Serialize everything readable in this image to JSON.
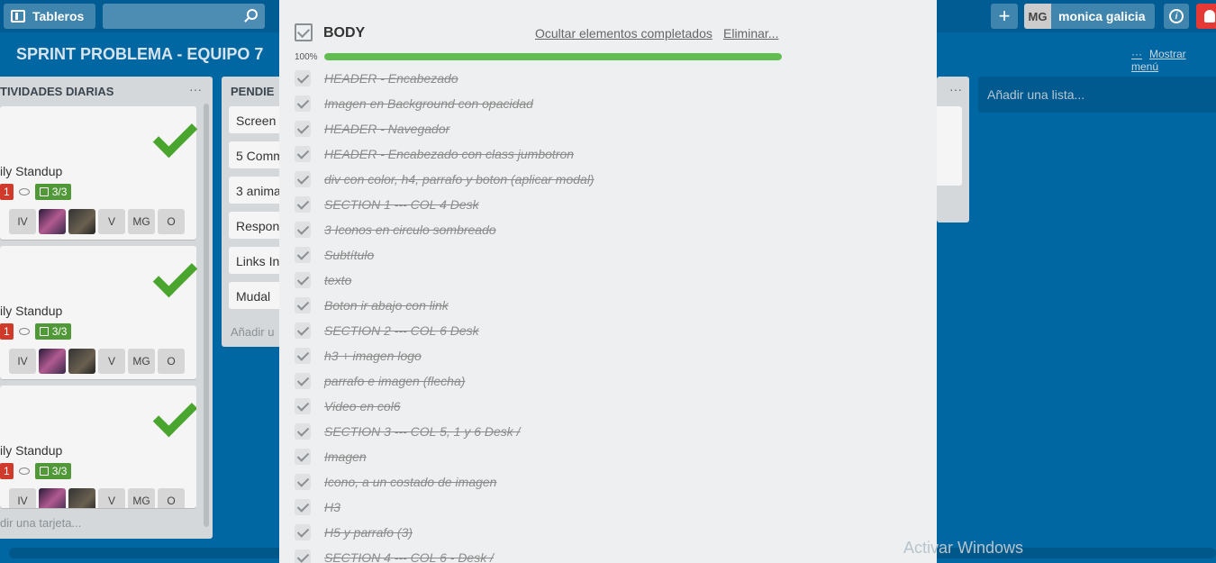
{
  "topbar": {
    "boards_label": "Tableros",
    "plus_label": "+",
    "user_initials": "MG",
    "user_name": "monica galicia",
    "info_label": "i"
  },
  "board": {
    "title": "SPRINT PROBLEMA - EQUIPO 7",
    "menu_dots": "···",
    "menu_label": "Mostrar menú"
  },
  "lists": {
    "daily": {
      "title": "TIVIDADES DIARIAS",
      "dots": "···",
      "add_card": "dir una tarjeta...",
      "cards": [
        {
          "title": "ily Standup",
          "red_badge": "1",
          "checklist": "3/3",
          "members": [
            "IV",
            "",
            "",
            "V",
            "MG",
            "O"
          ]
        },
        {
          "title": "ily Standup",
          "red_badge": "1",
          "checklist": "3/3",
          "members": [
            "IV",
            "",
            "",
            "V",
            "MG",
            "O"
          ]
        },
        {
          "title": "ily Standup",
          "red_badge": "1",
          "checklist": "3/3",
          "members": [
            "IV",
            "",
            "",
            "V",
            "MG",
            "O"
          ]
        }
      ]
    },
    "pending": {
      "title": "PENDIE",
      "items": [
        "Screen",
        "5 Comm",
        "3 anima",
        "Respon",
        "Links In",
        "Mudal"
      ],
      "add_card": "Añadir u"
    },
    "third": {
      "dots": "···"
    },
    "add_list": "Añadir una lista..."
  },
  "modal": {
    "title": "BODY",
    "hide_completed": "Ocultar elementos completados",
    "delete": "Eliminar...",
    "progress_label": "100%",
    "progress_fraction": 1.0,
    "items": [
      "HEADER - Encabezado",
      "Imagen en Background con opacidad",
      "HEADER - Navegador",
      "HEADER - Encabezado con class jumbotron",
      "div con color, h4, parrafo y boton (aplicar modal)",
      "SECTION 1 --- COL 4 Desk",
      "3 Iconos en circulo sombreado",
      "Subtítulo",
      "texto",
      "Boton ir abajo con link",
      "SECTION 2 --- COL 6 Desk",
      "h3 + imagen logo",
      "parrafo e imagen (flecha)",
      "Video en col6",
      "SECTION 3 --- COL 5, 1 y 6 Desk /",
      "Imagen ",
      "Icono, a un costado de imagen",
      "H3",
      "H5 y parrafo (3)",
      "SECTION 4 --- COL 6 - Desk /"
    ]
  },
  "watermark": "Activar Windows"
}
